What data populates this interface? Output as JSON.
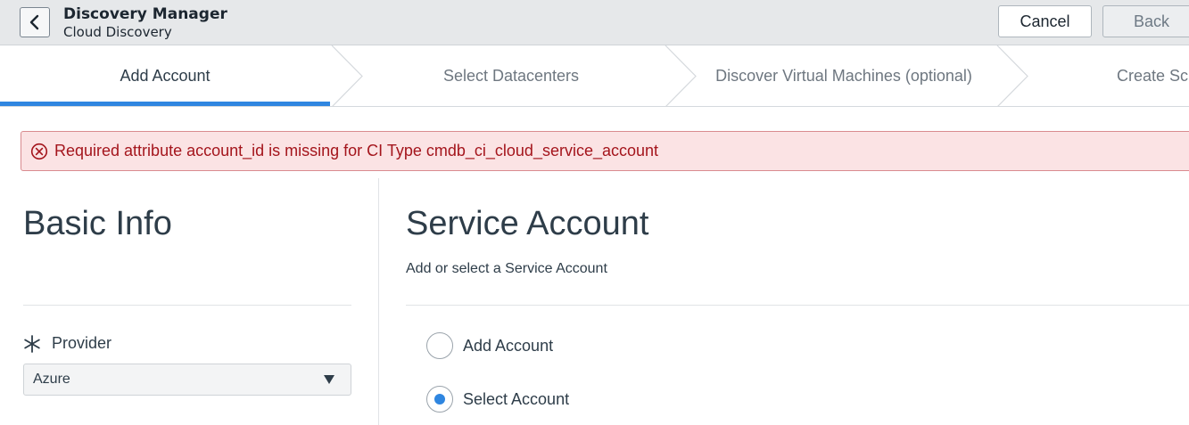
{
  "header": {
    "title": "Discovery Manager",
    "subtitle": "Cloud Discovery",
    "cancel_label": "Cancel",
    "back_label": "Back"
  },
  "wizard": {
    "steps": [
      {
        "label": "Add Account",
        "active": true
      },
      {
        "label": "Select Datacenters",
        "active": false
      },
      {
        "label": "Discover Virtual Machines (optional)",
        "active": false
      },
      {
        "label": "Create Sch",
        "active": false
      }
    ]
  },
  "alert": {
    "message": "Required attribute account_id is missing for CI Type cmdb_ci_cloud_service_account",
    "icon": "error-circle-icon",
    "color": "#a4151c"
  },
  "basic_info": {
    "heading": "Basic Info",
    "provider_label": "Provider",
    "provider_value": "Azure"
  },
  "service_account": {
    "heading": "Service Account",
    "subtitle": "Add or select a Service Account",
    "options": [
      {
        "label": "Add Account",
        "selected": false
      },
      {
        "label": "Select Account",
        "selected": true
      }
    ]
  },
  "colors": {
    "accent": "#2f86e0",
    "alert_bg": "#fbe3e4"
  }
}
